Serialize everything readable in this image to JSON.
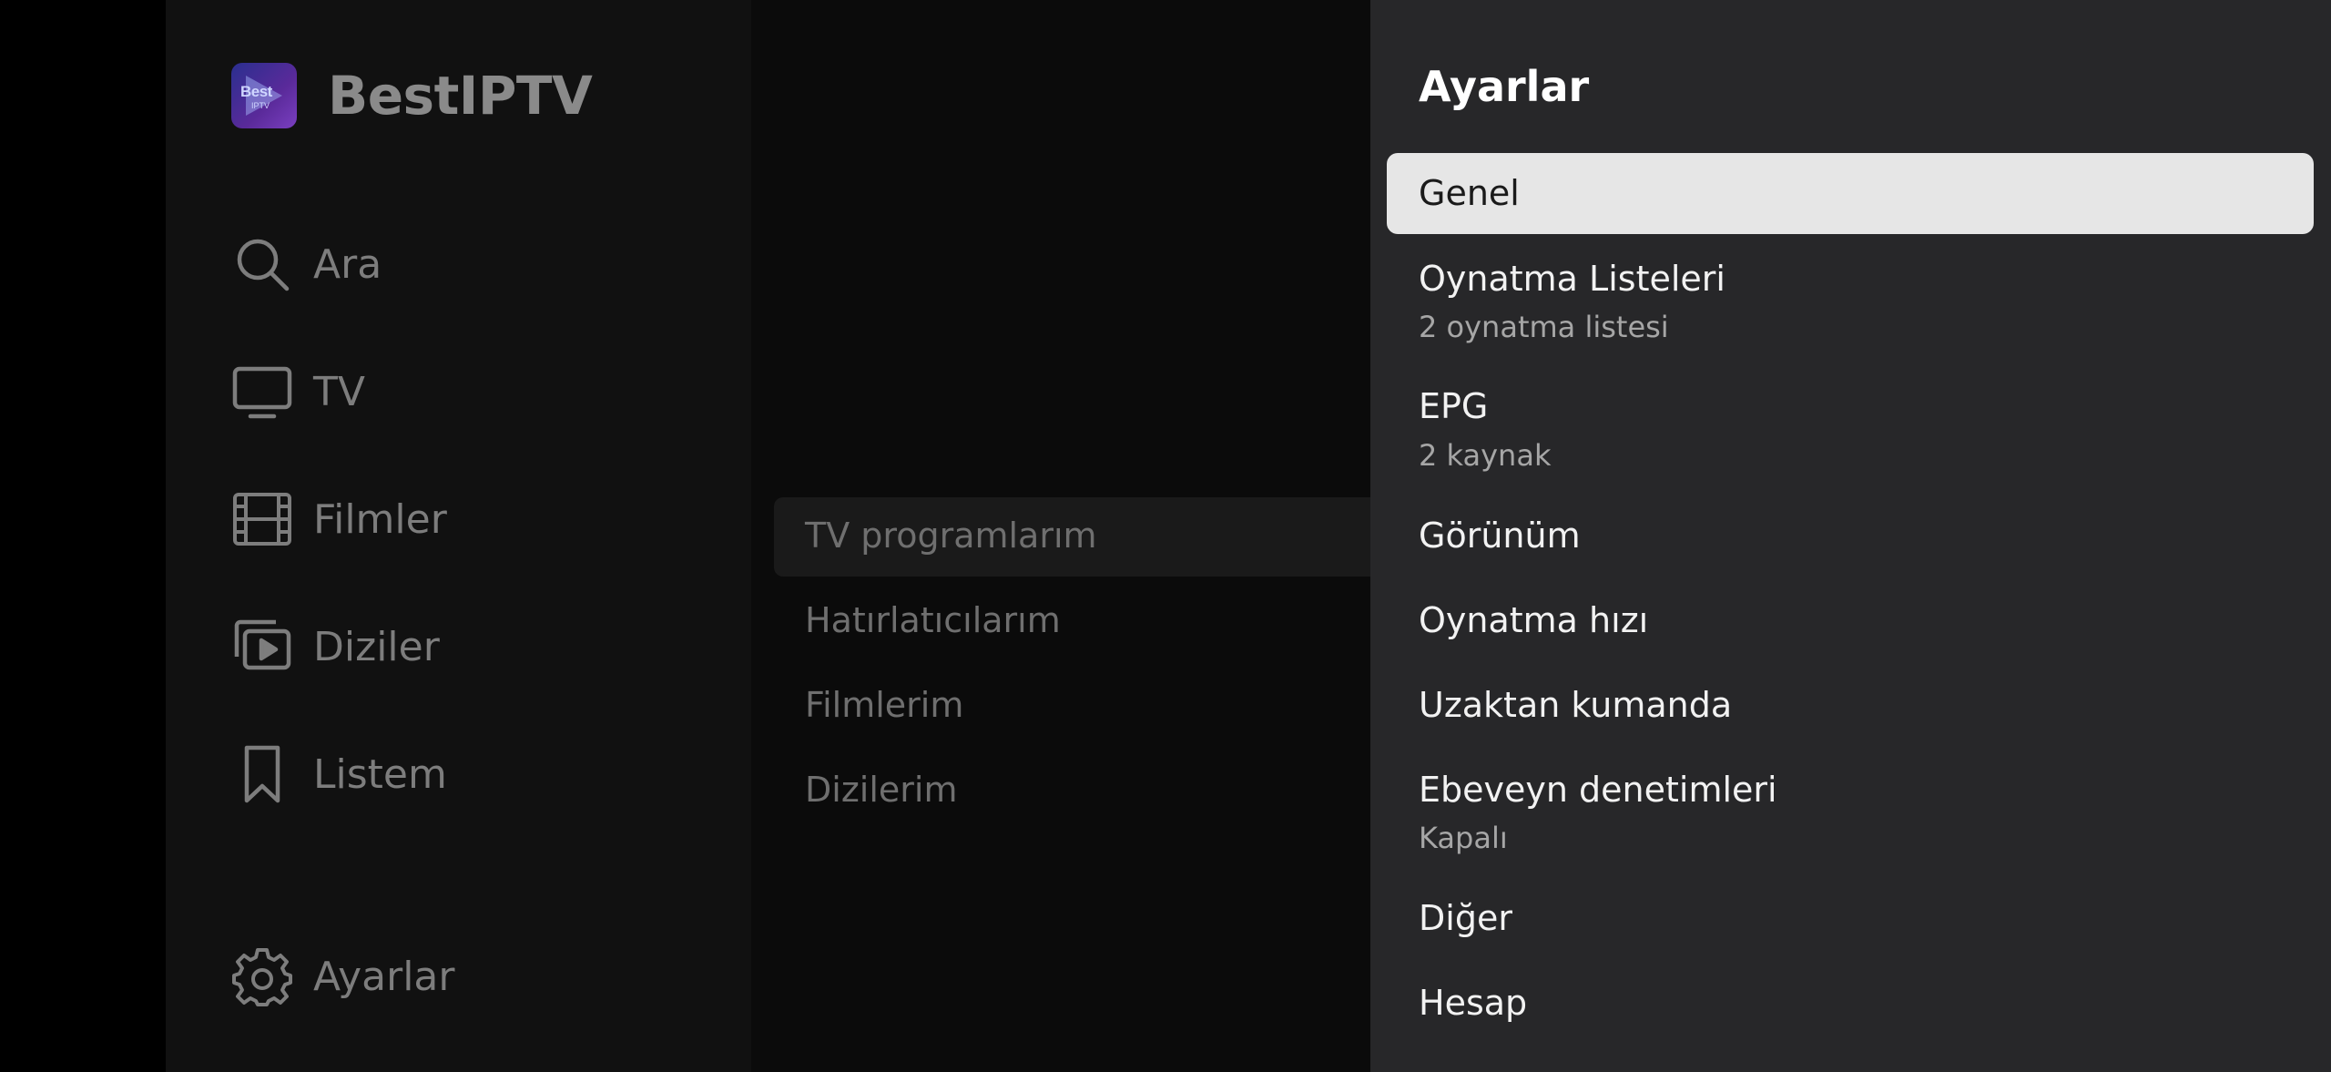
{
  "app": {
    "logo_text": "Best",
    "logo_subtext": "IPTV",
    "name": "BestIPTV"
  },
  "sidebar": {
    "items": [
      {
        "label": "Ara",
        "icon": "search-icon"
      },
      {
        "label": "TV",
        "icon": "tv-icon"
      },
      {
        "label": "Filmler",
        "icon": "film-icon"
      },
      {
        "label": "Diziler",
        "icon": "series-play-icon"
      },
      {
        "label": "Listem",
        "icon": "bookmark-icon"
      }
    ],
    "settings": {
      "label": "Ayarlar",
      "icon": "gear-icon"
    }
  },
  "library": {
    "items": [
      "TV programlarım",
      "Hatırlatıcılarım",
      "Filmlerim",
      "Dizilerim"
    ],
    "highlighted_index": 0
  },
  "settings": {
    "title": "Ayarlar",
    "selected_index": 0,
    "items": [
      {
        "label": "Genel"
      },
      {
        "label": "Oynatma Listeleri",
        "subtitle": "2 oynatma listesi"
      },
      {
        "label": "EPG",
        "subtitle": "2 kaynak"
      },
      {
        "label": "Görünüm"
      },
      {
        "label": "Oynatma hızı"
      },
      {
        "label": "Uzaktan kumanda"
      },
      {
        "label": "Ebeveyn denetimleri",
        "subtitle": "Kapalı"
      },
      {
        "label": "Diğer"
      },
      {
        "label": "Hesap"
      }
    ]
  },
  "colors": {
    "background": "#000000",
    "sidebar_bg": "#111111",
    "settings_bg": "#272729",
    "selected_bg": "#e6e6e6",
    "muted_text": "#7d7d7d"
  }
}
